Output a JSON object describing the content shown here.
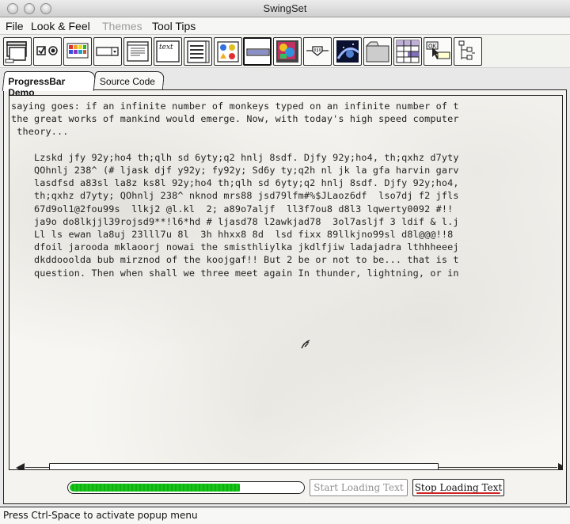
{
  "window": {
    "title": "SwingSet"
  },
  "menubar": {
    "items": [
      {
        "label": "File",
        "enabled": true
      },
      {
        "label": "Look & Feel",
        "enabled": true
      },
      {
        "label": "Themes",
        "enabled": false
      },
      {
        "label": "Tool Tips",
        "enabled": true
      }
    ]
  },
  "toolbar": {
    "buttons": [
      {
        "icon": "internal-frame-icon"
      },
      {
        "icon": "checkbox-radio-icon"
      },
      {
        "icon": "color-chooser-icon"
      },
      {
        "icon": "combobox-icon"
      },
      {
        "icon": "file-chooser-icon"
      },
      {
        "icon": "text-editor-icon",
        "text": "text"
      },
      {
        "icon": "list-icon"
      },
      {
        "icon": "option-pane-icon"
      },
      {
        "icon": "progress-bar-icon",
        "selected": true
      },
      {
        "icon": "scroll-pane-icon"
      },
      {
        "icon": "slider-icon"
      },
      {
        "icon": "split-pane-icon"
      },
      {
        "icon": "tabbed-pane-icon"
      },
      {
        "icon": "table-icon"
      },
      {
        "icon": "tooltip-icon",
        "text": "OK"
      },
      {
        "icon": "tree-icon"
      }
    ]
  },
  "tabs": [
    {
      "label": "ProgressBar Demo",
      "active": true
    },
    {
      "label": "Source Code",
      "active": false
    }
  ],
  "content": {
    "text": "saying goes: if an infinite number of monkeys typed on an infinite number of t\nthe great works of mankind would emerge. Now, with today's high speed computer\n theory...\n\n    Lzskd jfy 92y;ho4 th;qlh sd 6yty;q2 hnlj 8sdf. Djfy 92y;ho4, th;qxhz d7yty\n    QOhnlj 238^ (# ljask djf y92y; fy92y; Sd6y ty;q2h nl jk la gfa harvin garv\n    lasdfsd a83sl la8z ks8l 92y;ho4 th;qlh sd 6yty;q2 hnlj 8sdf. Djfy 92y;ho4,\n    th;qxhz d7yty; QOhnlj 238^ nknod mrs88 jsd79lfm#%$JLaoz6df  lso7dj f2 jfls\n    67d9ol1@2fou99s  llkj2 @l.kl  2; a89o7aljf  ll3f7ou8 d8l3 lqwerty0092 #!!\n    ja9o do8lkjjl39rojsd9**!l6*hd # ljasd78 l2awkjad78  3ol7asljf 3 ldif & l.j\n    Ll ls ewan la8uj 23lll7u 8l  3h hhxx8 8d  lsd fixx 89llkjno99sl d8l@@@!!8\n    dfoil jarooda mklaoorj nowai the smisthliylka jkdlfjiw ladajadra lthhheeej\n    dkddooolda bub mirznod of the koojgaf!! But 2 be or not to be... that is t\n    question. Then when shall we three meet again In thunder, lightning, or in"
  },
  "progress": {
    "fraction": 0.73
  },
  "buttons": {
    "start_label": "Start Loading Text",
    "stop_label": "Stop Loading Text"
  },
  "status": {
    "text": "Press Ctrl-Space to activate popup menu"
  },
  "colors": {
    "progress_fill": "#19c41a",
    "stop_underline": "#d12020"
  }
}
